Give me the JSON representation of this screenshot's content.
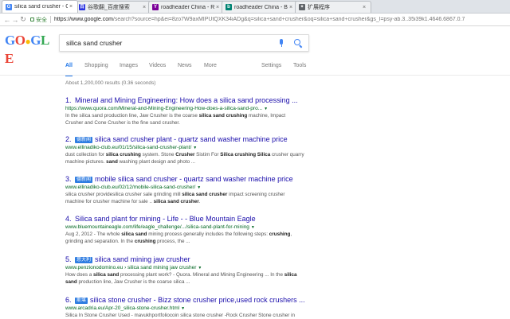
{
  "browser": {
    "tabs": [
      {
        "title": "silica sand crusher - Go",
        "icon_color": "#4285f4",
        "icon_letter": "G",
        "active": true
      },
      {
        "title": "谷歌翻_百度搜索",
        "icon_color": "#2932e1",
        "icon_letter": "百",
        "active": false
      },
      {
        "title": "roadheader China - Ric",
        "icon_color": "#7b0099",
        "icon_letter": "Y",
        "active": false
      },
      {
        "title": "roadheader China - Bin",
        "icon_color": "#008373",
        "icon_letter": "b",
        "active": false
      },
      {
        "title": "扩展程序",
        "icon_color": "#5f6368",
        "icon_letter": "✦",
        "active": false
      }
    ],
    "secure_label": "安全",
    "url_host": "https://www.google.com",
    "url_rest": "/search?source=hp&ei=8zo7W9axMIPUtQXK34iADg&q=silica+sand+crusher&oq=silica+sand+crusher&gs_l=psy-ab.3..35i39k1.4646.6867.0.7"
  },
  "logo_letters": [
    {
      "ch": "G",
      "color": "#4285f4"
    },
    {
      "ch": "O",
      "color": "#ea4335"
    },
    {
      "ch": "●",
      "color": "#fbbc05"
    },
    {
      "ch": "G",
      "color": "#4285f4"
    },
    {
      "ch": "L",
      "color": "#34a853"
    },
    {
      "ch": "E",
      "color": "#ea4335"
    }
  ],
  "search": {
    "query": "silica sand crusher"
  },
  "search_tabs": [
    {
      "label": "All",
      "active": true
    },
    {
      "label": "Shopping",
      "active": false
    },
    {
      "label": "Images",
      "active": false
    },
    {
      "label": "Videos",
      "active": false
    },
    {
      "label": "News",
      "active": false
    },
    {
      "label": "More",
      "active": false
    },
    {
      "label": "Settings",
      "active": false
    },
    {
      "label": "Tools",
      "active": false
    }
  ],
  "stats": "About 1,200,000 results (0.36 seconds)",
  "results": [
    {
      "num": "1.",
      "badge": "",
      "title": "Mineral and Mining Engineering: How does a silica sand processing ...",
      "url": "https://www.quora.com/Mineral-and-Mining-Engineering-How-does-a-silica-sand-pro...",
      "snippet": "In the silica sand production line, Jaw Crusher is the coarse <b>silica sand crushing</b> machine, Impact Crusher and Cone Crusher is the fine sand crusher."
    },
    {
      "num": "2.",
      "badge": "德新闻",
      "title": "silica sand crusher plant - quartz sand washer machine price",
      "url": "www.ellinadiko-club.eu/01/15/silica-sand-crusher-plant/",
      "snippet": "dust collection for <b>silica crushing</b> system. Stone <b>Crusher</b> Sistim For <b>Silica crushing Silica</b> crusher quarry machine pictures. <b>sand</b> washing plant design and photo ..."
    },
    {
      "num": "3.",
      "badge": "德新闻",
      "title": "mobile silica sand crusher - quartz sand washer machine price",
      "url": "www.ellinadiko-club.eu/02/12/mobile-silica-sand-crusher/",
      "snippet": "silica crusher providesilica crusher sale grinding mill <b>silica sand crusher</b> impact screening crusher machine for crusher machine for sale .. <b>silica sand crusher</b>."
    },
    {
      "num": "4.",
      "badge": "",
      "title": "Silica sand plant for mining - Life - - Blue Mountain Eagle",
      "url": "www.bluemountaineagle.com/life/eagle_challenge/.../silica-sand-plant-for-mining",
      "snippet": "Aug 2, 2012 - The whole <b>silica sand</b> mining process generally includes the following steps: <b>crushing</b>, grinding and separation. In the <b>crushing</b> process, the ..."
    },
    {
      "num": "5.",
      "badge": "意大利",
      "title": "silica sand mining jaw crusher",
      "url": "www.penzionodomino.eu › silica sand mining jaw crusher",
      "snippet": "How does a <b>silica sand</b> processing plant work? - Quora. Mineral and Mining Engineering ... In the <b>silica sand</b> production line, Jaw Crusher is the coarse silica ..."
    },
    {
      "num": "6.",
      "badge": "斯堪",
      "title": "silica stone crusher - Bizz stone crusher price,used rock crushers ...",
      "url": "www.arcadria.eu/Apr-20_silica-stone-crusher.html",
      "snippet": "Silica In Stone Crusher Used - mavukhportfoliocoin silica stone crusher -Rock Crusher Stone crusher in"
    }
  ]
}
